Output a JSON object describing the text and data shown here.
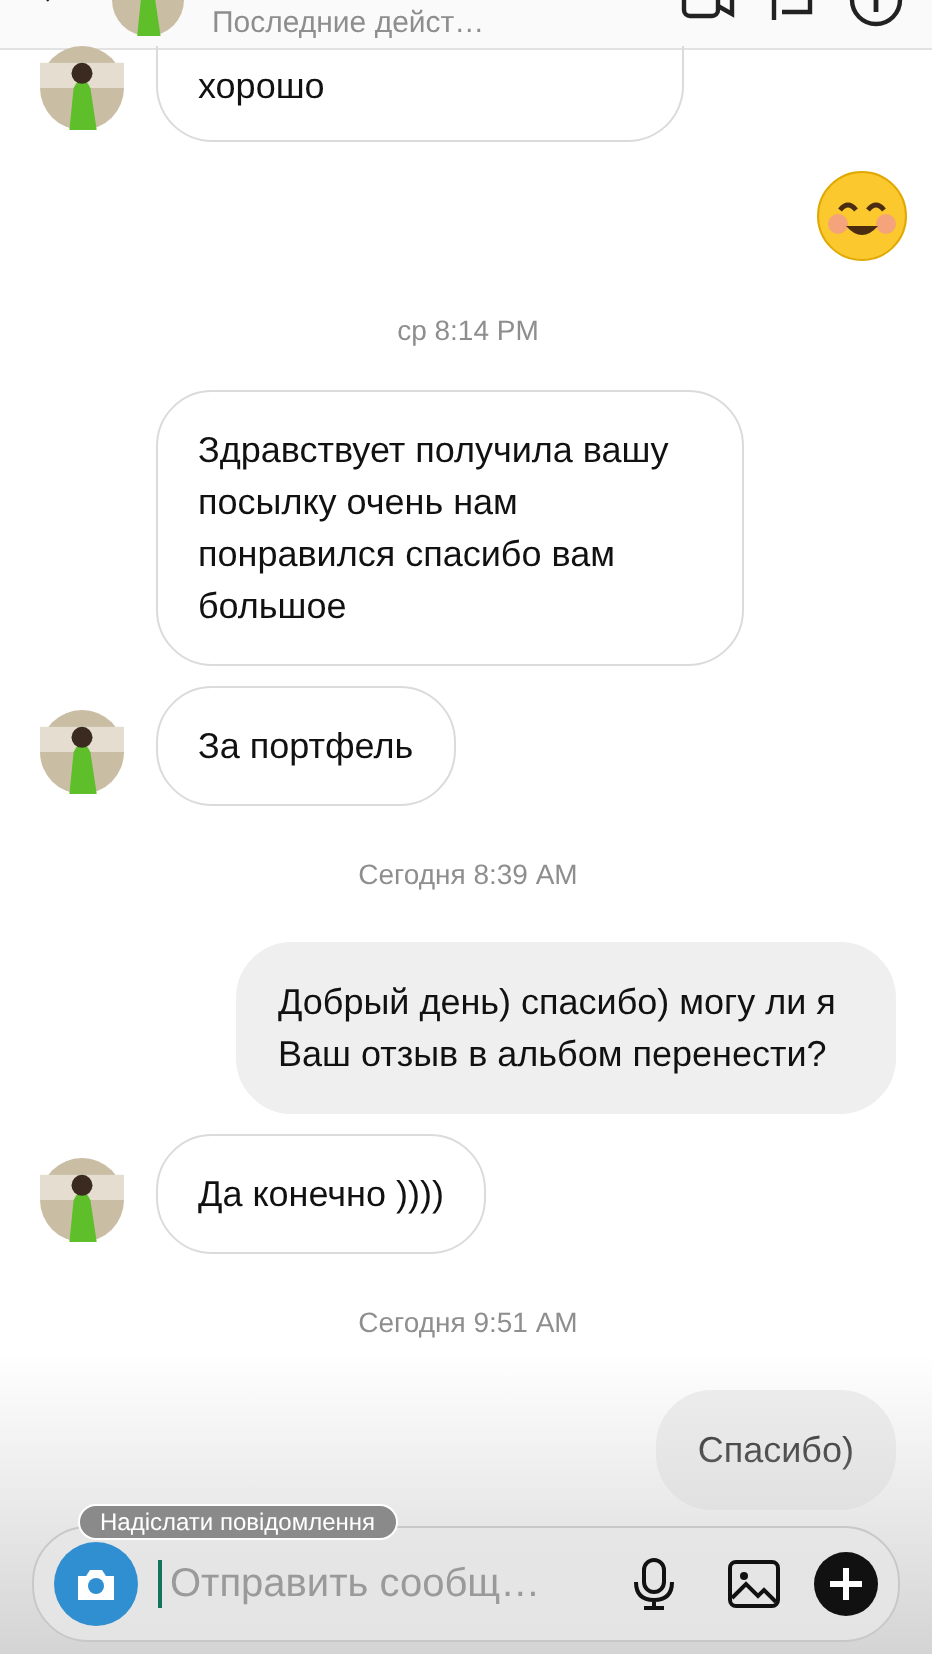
{
  "header": {
    "status": "Последние дейст…"
  },
  "messages": [
    {
      "kind": "received",
      "text": "хорошо",
      "avatar": true,
      "clipped": true
    },
    {
      "kind": "emoji"
    },
    {
      "kind": "time",
      "text": "ср 8:14 PM"
    },
    {
      "kind": "received",
      "text": "Здравствует получила вашу посылку очень нам понравился спасибо вам большое",
      "avatar": false,
      "clipped": false
    },
    {
      "kind": "received",
      "text": "За портфель",
      "avatar": true,
      "clipped": false
    },
    {
      "kind": "time",
      "text": "Сегодня 8:39 AM"
    },
    {
      "kind": "sent",
      "text": "Добрый день) спасибо) могу ли я Ваш отзыв в альбом перенести?"
    },
    {
      "kind": "received",
      "text": "Да конечно ))))",
      "avatar": true,
      "clipped": false
    },
    {
      "kind": "time",
      "text": "Сегодня 9:51 AM"
    },
    {
      "kind": "sent",
      "text": "Спасибо)"
    }
  ],
  "composer": {
    "placeholder": "Отправить сообщ…",
    "overlay_text": "Надіслати повідомлення"
  }
}
